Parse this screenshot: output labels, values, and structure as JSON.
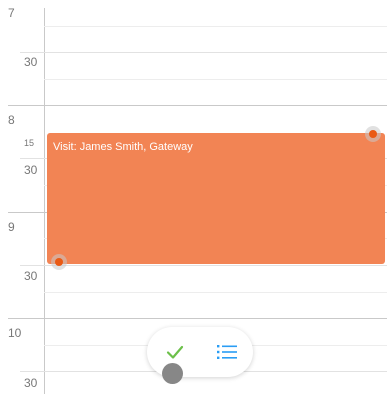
{
  "time_grid": {
    "hour_7": "7",
    "half_7": "30",
    "hour_8": "8",
    "quarter_8": "15",
    "half_8": "30",
    "hour_9": "9",
    "half_9": "30",
    "hour_10": "10",
    "half_10": "30"
  },
  "event": {
    "title": "Visit: James Smith, Gateway",
    "color": "#f28454",
    "handle_color": "#ea5a14"
  },
  "actions": {
    "confirm_icon": "check-icon",
    "confirm_color": "#6cc04a",
    "list_icon": "list-icon",
    "list_color": "#2a9df4"
  }
}
